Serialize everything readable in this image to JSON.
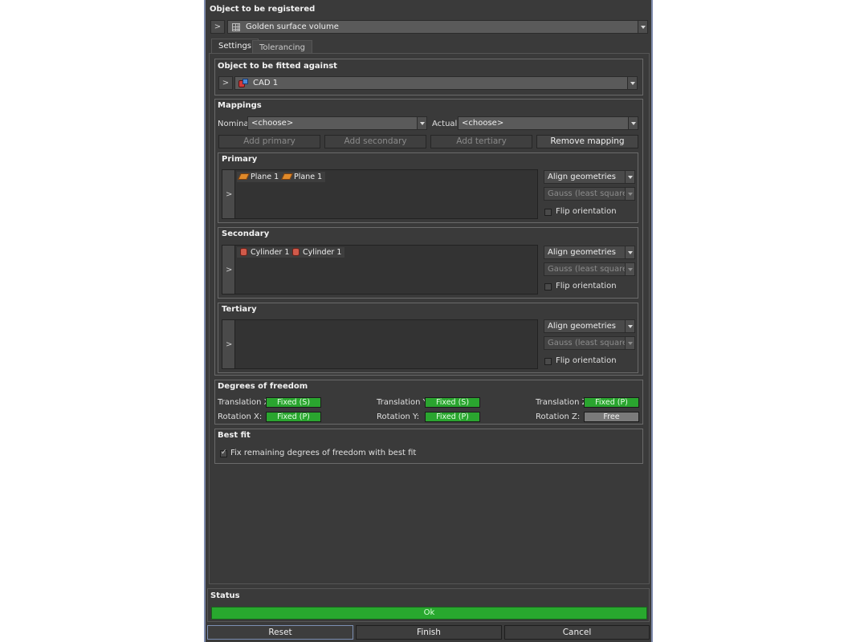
{
  "header": {
    "title": "Object to be registered"
  },
  "registered_object": {
    "expander": ">",
    "value": "Golden surface volume",
    "icon": "grid-icon"
  },
  "tabs": [
    {
      "label": "Settings",
      "active": true
    },
    {
      "label": "Tolerancing",
      "active": false
    }
  ],
  "fit_against": {
    "title": "Object to be fitted against",
    "expander": ">",
    "value": "CAD 1",
    "icon": "cad-icon"
  },
  "mappings": {
    "title": "Mappings",
    "nominal_label": "Nominal",
    "nominal_value": "<choose>",
    "actual_label": "Actual",
    "actual_value": "<choose>",
    "buttons": {
      "add_primary": "Add primary",
      "add_secondary": "Add secondary",
      "add_tertiary": "Add tertiary",
      "remove_mapping": "Remove mapping"
    }
  },
  "primary": {
    "title": "Primary",
    "expander": ">",
    "items": [
      "Plane 1",
      "Plane 1"
    ],
    "align": "Align geometries",
    "method": "Gauss (least squares)",
    "flip": "Flip orientation"
  },
  "secondary": {
    "title": "Secondary",
    "expander": ">",
    "items": [
      "Cylinder 1",
      "Cylinder 1"
    ],
    "align": "Align geometries",
    "method": "Gauss (least squares)",
    "flip": "Flip orientation"
  },
  "tertiary": {
    "title": "Tertiary",
    "expander": ">",
    "align": "Align geometries",
    "method": "Gauss (least squares)",
    "flip": "Flip orientation"
  },
  "dof": {
    "title": "Degrees of freedom",
    "tx_label": "Translation X:",
    "tx_value": "Fixed (S)",
    "ty_label": "Translation Y:",
    "ty_value": "Fixed (S)",
    "tz_label": "Translation Z:",
    "tz_value": "Fixed (P)",
    "rx_label": "Rotation X:",
    "rx_value": "Fixed (P)",
    "ry_label": "Rotation Y:",
    "ry_value": "Fixed (P)",
    "rz_label": "Rotation Z:",
    "rz_value": "Free",
    "colors": {
      "fixed": "#2aa52f",
      "free": "#7a7a7a"
    }
  },
  "best_fit": {
    "title": "Best fit",
    "checkbox_label": "Fix remaining degrees of freedom with best fit",
    "checked": true
  },
  "status": {
    "title": "Status",
    "value": "Ok",
    "color": "#28a82e"
  },
  "footer": {
    "reset": "Reset",
    "finish": "Finish",
    "cancel": "Cancel"
  }
}
